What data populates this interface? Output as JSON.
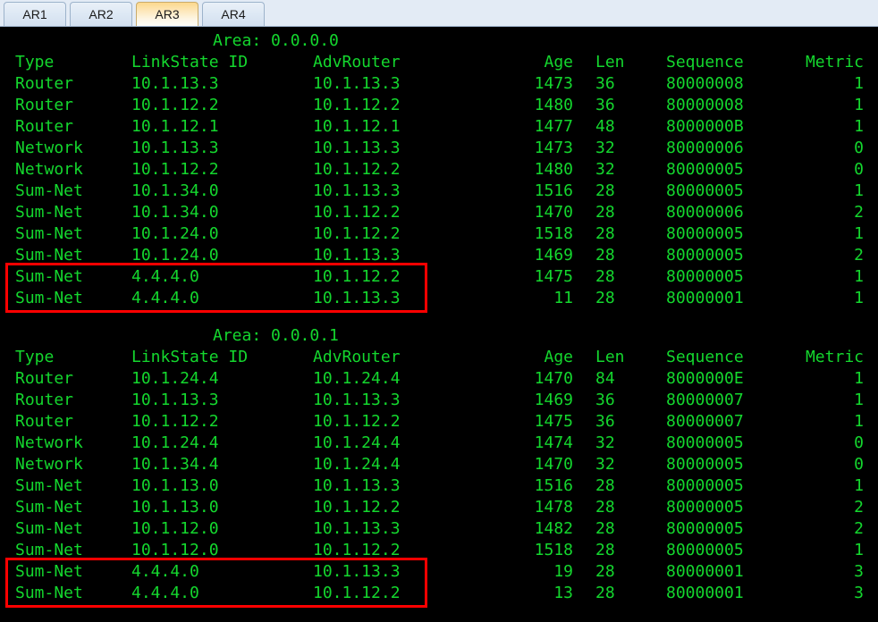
{
  "window": {
    "title": "AR3",
    "background": "#000000",
    "text_color": "#14d72e",
    "highlight_color": "#fe0000"
  },
  "tabs": [
    {
      "label": "AR1",
      "active": false
    },
    {
      "label": "AR2",
      "active": false
    },
    {
      "label": "AR3",
      "active": true
    },
    {
      "label": "AR4",
      "active": false
    }
  ],
  "columns": {
    "type": "Type",
    "linkstate_id": "LinkState ID",
    "advrouter": "AdvRouter",
    "age": "Age",
    "len": "Len",
    "sequence": "Sequence",
    "metric": "Metric"
  },
  "sections": [
    {
      "area_label": "Area: 0.0.0.0",
      "rows": [
        {
          "type": "Router",
          "lsid": "10.1.13.3",
          "adv": "10.1.13.3",
          "age": "1473",
          "len": "36",
          "seq": "80000008",
          "metric": "1",
          "highlight": false
        },
        {
          "type": "Router",
          "lsid": "10.1.12.2",
          "adv": "10.1.12.2",
          "age": "1480",
          "len": "36",
          "seq": "80000008",
          "metric": "1",
          "highlight": false
        },
        {
          "type": "Router",
          "lsid": "10.1.12.1",
          "adv": "10.1.12.1",
          "age": "1477",
          "len": "48",
          "seq": "8000000B",
          "metric": "1",
          "highlight": false
        },
        {
          "type": "Network",
          "lsid": "10.1.13.3",
          "adv": "10.1.13.3",
          "age": "1473",
          "len": "32",
          "seq": "80000006",
          "metric": "0",
          "highlight": false
        },
        {
          "type": "Network",
          "lsid": "10.1.12.2",
          "adv": "10.1.12.2",
          "age": "1480",
          "len": "32",
          "seq": "80000005",
          "metric": "0",
          "highlight": false
        },
        {
          "type": "Sum-Net",
          "lsid": "10.1.34.0",
          "adv": "10.1.13.3",
          "age": "1516",
          "len": "28",
          "seq": "80000005",
          "metric": "1",
          "highlight": false
        },
        {
          "type": "Sum-Net",
          "lsid": "10.1.34.0",
          "adv": "10.1.12.2",
          "age": "1470",
          "len": "28",
          "seq": "80000006",
          "metric": "2",
          "highlight": false
        },
        {
          "type": "Sum-Net",
          "lsid": "10.1.24.0",
          "adv": "10.1.12.2",
          "age": "1518",
          "len": "28",
          "seq": "80000005",
          "metric": "1",
          "highlight": false
        },
        {
          "type": "Sum-Net",
          "lsid": "10.1.24.0",
          "adv": "10.1.13.3",
          "age": "1469",
          "len": "28",
          "seq": "80000005",
          "metric": "2",
          "highlight": false
        },
        {
          "type": "Sum-Net",
          "lsid": "4.4.4.0",
          "adv": "10.1.12.2",
          "age": "1475",
          "len": "28",
          "seq": "80000005",
          "metric": "1",
          "highlight": true
        },
        {
          "type": "Sum-Net",
          "lsid": "4.4.4.0",
          "adv": "10.1.13.3",
          "age": "11",
          "len": "28",
          "seq": "80000001",
          "metric": "1",
          "highlight": true
        }
      ]
    },
    {
      "area_label": "Area: 0.0.0.1",
      "rows": [
        {
          "type": "Router",
          "lsid": "10.1.24.4",
          "adv": "10.1.24.4",
          "age": "1470",
          "len": "84",
          "seq": "8000000E",
          "metric": "1",
          "highlight": false
        },
        {
          "type": "Router",
          "lsid": "10.1.13.3",
          "adv": "10.1.13.3",
          "age": "1469",
          "len": "36",
          "seq": "80000007",
          "metric": "1",
          "highlight": false
        },
        {
          "type": "Router",
          "lsid": "10.1.12.2",
          "adv": "10.1.12.2",
          "age": "1475",
          "len": "36",
          "seq": "80000007",
          "metric": "1",
          "highlight": false
        },
        {
          "type": "Network",
          "lsid": "10.1.24.4",
          "adv": "10.1.24.4",
          "age": "1474",
          "len": "32",
          "seq": "80000005",
          "metric": "0",
          "highlight": false
        },
        {
          "type": "Network",
          "lsid": "10.1.34.4",
          "adv": "10.1.24.4",
          "age": "1470",
          "len": "32",
          "seq": "80000005",
          "metric": "0",
          "highlight": false
        },
        {
          "type": "Sum-Net",
          "lsid": "10.1.13.0",
          "adv": "10.1.13.3",
          "age": "1516",
          "len": "28",
          "seq": "80000005",
          "metric": "1",
          "highlight": false
        },
        {
          "type": "Sum-Net",
          "lsid": "10.1.13.0",
          "adv": "10.1.12.2",
          "age": "1478",
          "len": "28",
          "seq": "80000005",
          "metric": "2",
          "highlight": false
        },
        {
          "type": "Sum-Net",
          "lsid": "10.1.12.0",
          "adv": "10.1.13.3",
          "age": "1482",
          "len": "28",
          "seq": "80000005",
          "metric": "2",
          "highlight": false
        },
        {
          "type": "Sum-Net",
          "lsid": "10.1.12.0",
          "adv": "10.1.12.2",
          "age": "1518",
          "len": "28",
          "seq": "80000005",
          "metric": "1",
          "highlight": false
        },
        {
          "type": "Sum-Net",
          "lsid": "4.4.4.0",
          "adv": "10.1.13.3",
          "age": "19",
          "len": "28",
          "seq": "80000001",
          "metric": "3",
          "highlight": true
        },
        {
          "type": "Sum-Net",
          "lsid": "4.4.4.0",
          "adv": "10.1.12.2",
          "age": "13",
          "len": "28",
          "seq": "80000001",
          "metric": "3",
          "highlight": true
        }
      ]
    }
  ]
}
